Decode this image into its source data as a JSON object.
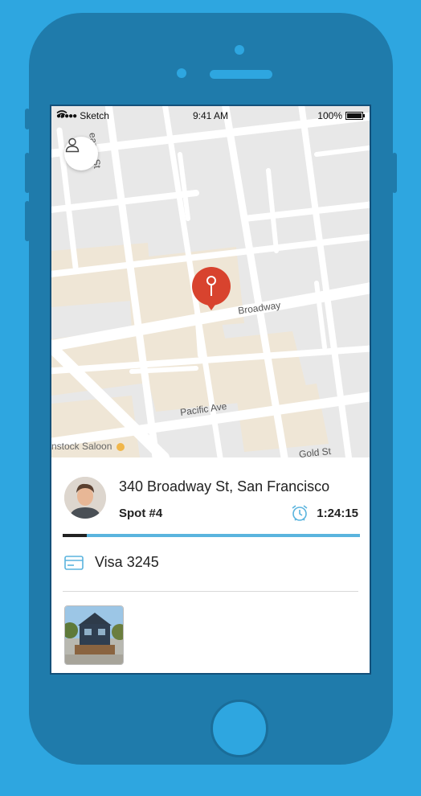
{
  "status_bar": {
    "carrier": "Sketch",
    "time": "9:41 AM",
    "battery": "100%"
  },
  "map": {
    "labels": {
      "broadway": "Broadway",
      "pacific": "Pacific Ave",
      "gold": "Gold St",
      "kearny": "earny St",
      "saloon": "nstock Saloon"
    }
  },
  "booking": {
    "address": "340 Broadway St, San Francisco",
    "spot": "Spot #4",
    "time_remaining": "1:24:15",
    "progress_fraction": 0.08
  },
  "payment": {
    "label": "Visa 3245"
  },
  "colors": {
    "background": "#2ea6e0",
    "phone": "#1f7bab",
    "accent": "#5ab4de",
    "pin": "#d8432e"
  },
  "icons": {
    "profile": "person-icon",
    "timer": "alarm-clock-icon",
    "payment": "credit-card-icon",
    "pin": "location-pin-icon"
  }
}
